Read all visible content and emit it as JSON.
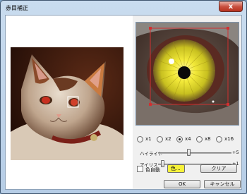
{
  "window": {
    "title": "赤目補正"
  },
  "zoom": {
    "options": [
      {
        "label": "x1",
        "checked": false
      },
      {
        "label": "x2",
        "checked": false
      },
      {
        "label": "x4",
        "checked": true
      },
      {
        "label": "x8",
        "checked": false
      },
      {
        "label": "x16",
        "checked": false
      }
    ]
  },
  "highlight": {
    "label": "ハイライト",
    "value": "+5",
    "level": 0.55
  },
  "iris": {
    "label": "アイリス",
    "value": "+1",
    "level": 0.05
  },
  "auto_color": {
    "label": "色自動",
    "checked": false
  },
  "color_button": {
    "label": "色...",
    "color": "#f7f23a"
  },
  "clear_button": {
    "label": "クリア"
  },
  "ok_button": {
    "label": "OK"
  },
  "cancel_button": {
    "label": "キャンセル"
  },
  "close_button": {
    "label": "x"
  }
}
